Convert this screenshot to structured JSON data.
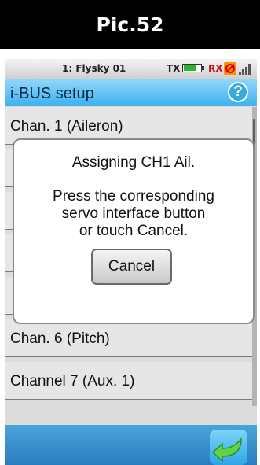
{
  "caption": "Pic.52",
  "status_bar": {
    "model_name": "1: Flysky 01",
    "tx_label": "TX",
    "rx_label": "RX",
    "tx_battery_level": 0.7,
    "icons": [
      "tx-battery-icon",
      "rx-no-signal-icon",
      "signal-bars-icon"
    ]
  },
  "header": {
    "title": "i-BUS setup",
    "help_icon": "?"
  },
  "list": {
    "items": [
      {
        "label": "Chan. 1 (Aileron)"
      },
      {
        "label": ""
      },
      {
        "label": ""
      },
      {
        "label": ""
      },
      {
        "label": ""
      },
      {
        "label": "Chan. 6 (Pitch)"
      },
      {
        "label": "Channel 7 (Aux. 1)"
      }
    ]
  },
  "dialog": {
    "title": "Assigning CH1 Ail.",
    "body_lines": [
      "Press the corresponding",
      "servo interface button",
      "or touch Cancel."
    ],
    "cancel_label": "Cancel"
  },
  "footer": {
    "back_icon": "back-arrow-icon"
  },
  "colors": {
    "title_bar": "#3db1ec",
    "bottom_bar": "#2a7ec0",
    "rx_label": "#d41010",
    "tx_battery_fill": "#2bb52b"
  }
}
